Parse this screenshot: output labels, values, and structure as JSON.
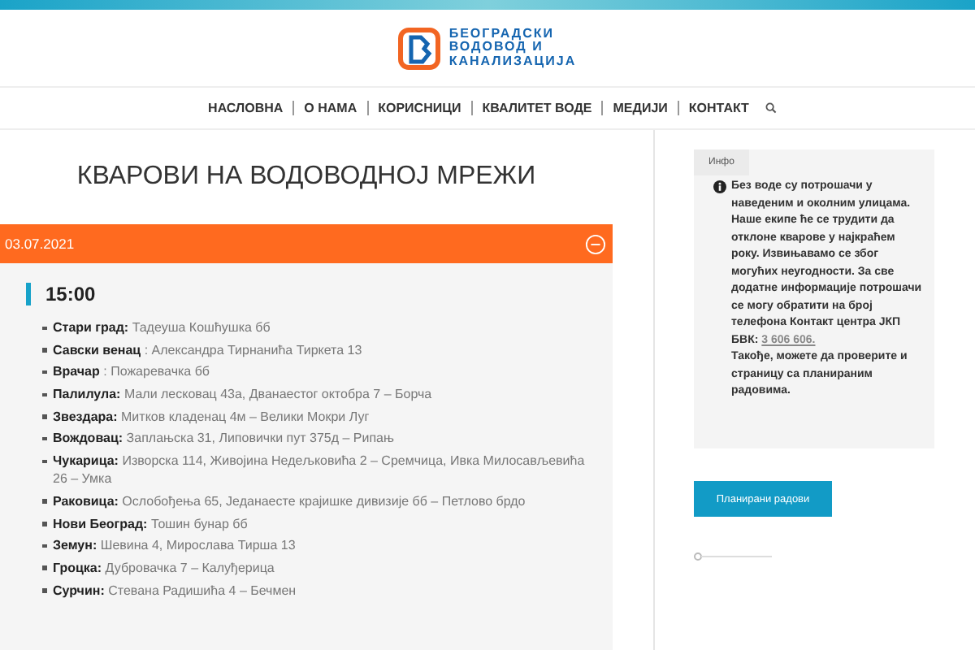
{
  "logo": {
    "lines": [
      "БЕОГРАДСКИ",
      "ВОДОВОД И",
      "КАНАЛИЗАЦИЈА"
    ]
  },
  "nav": {
    "items": [
      "НАСЛОВНА",
      "О НАМА",
      "КОРИСНИЦИ",
      "КВАЛИТЕТ ВОДЕ",
      "МЕДИЈИ",
      "КОНТАКТ"
    ]
  },
  "page_title": "КВАРОВИ НА ВОДОВОДНОЈ МРЕЖИ",
  "accordion": {
    "date": "03.07.2021",
    "expanded": true,
    "time": "15:00",
    "items": [
      {
        "district": "Стари град:",
        "streets": "Тадеуша Кошћушка бб"
      },
      {
        "district": "Савски венац",
        "streets": ": Александра Тирнанића Тиркета 13"
      },
      {
        "district": "Врачар",
        "streets": ": Пожаревачка бб"
      },
      {
        "district": "Палилула:",
        "streets": "Мали лесковац 43а, Дванаестог октобра 7 – Борча"
      },
      {
        "district": "Звездара:",
        "streets": "Митков кладенац 4м – Велики Мокри Луг"
      },
      {
        "district": "Вождовац:",
        "streets": "Заплањска 31, Липовички пут 375д – Рипањ"
      },
      {
        "district": "Чукарица:",
        "streets": "Изворска 114, Живојина Недељковића 2 – Сремчица, Ивка Милосављевића 26 – Умка"
      },
      {
        "district": "Раковица:",
        "streets": "Ослобођења 65, Једанаесте крајишке дивизије бб – Петлово брдо"
      },
      {
        "district": "Нови Београд:",
        "streets": "Тошин бунар бб"
      },
      {
        "district": "Земун:",
        "streets": "Шевина 4, Мирослава Тирша 13"
      },
      {
        "district": "Гроцка:",
        "streets": "Дубровачка 7 – Калуђерица"
      },
      {
        "district": "Сурчин:",
        "streets": "Стевана Радишића 4 – Бечмен"
      }
    ]
  },
  "sidebar": {
    "info_tab": "Инфо",
    "text_before": "Без воде су потрошачи у наведеним и околним улицама. Наше екипе ће се трудити да отклоне кварове у најкраћем року. Извињавамо се због могућих неугодности. За све додатне информације потрошачи се могу обратити на број телефона Контакт центра ЈКП БВК:",
    "link": "3 606 606.",
    "text_after": "Такође, можете да проверите и страницу са планираним радовима.",
    "button": "Планирани радови"
  }
}
